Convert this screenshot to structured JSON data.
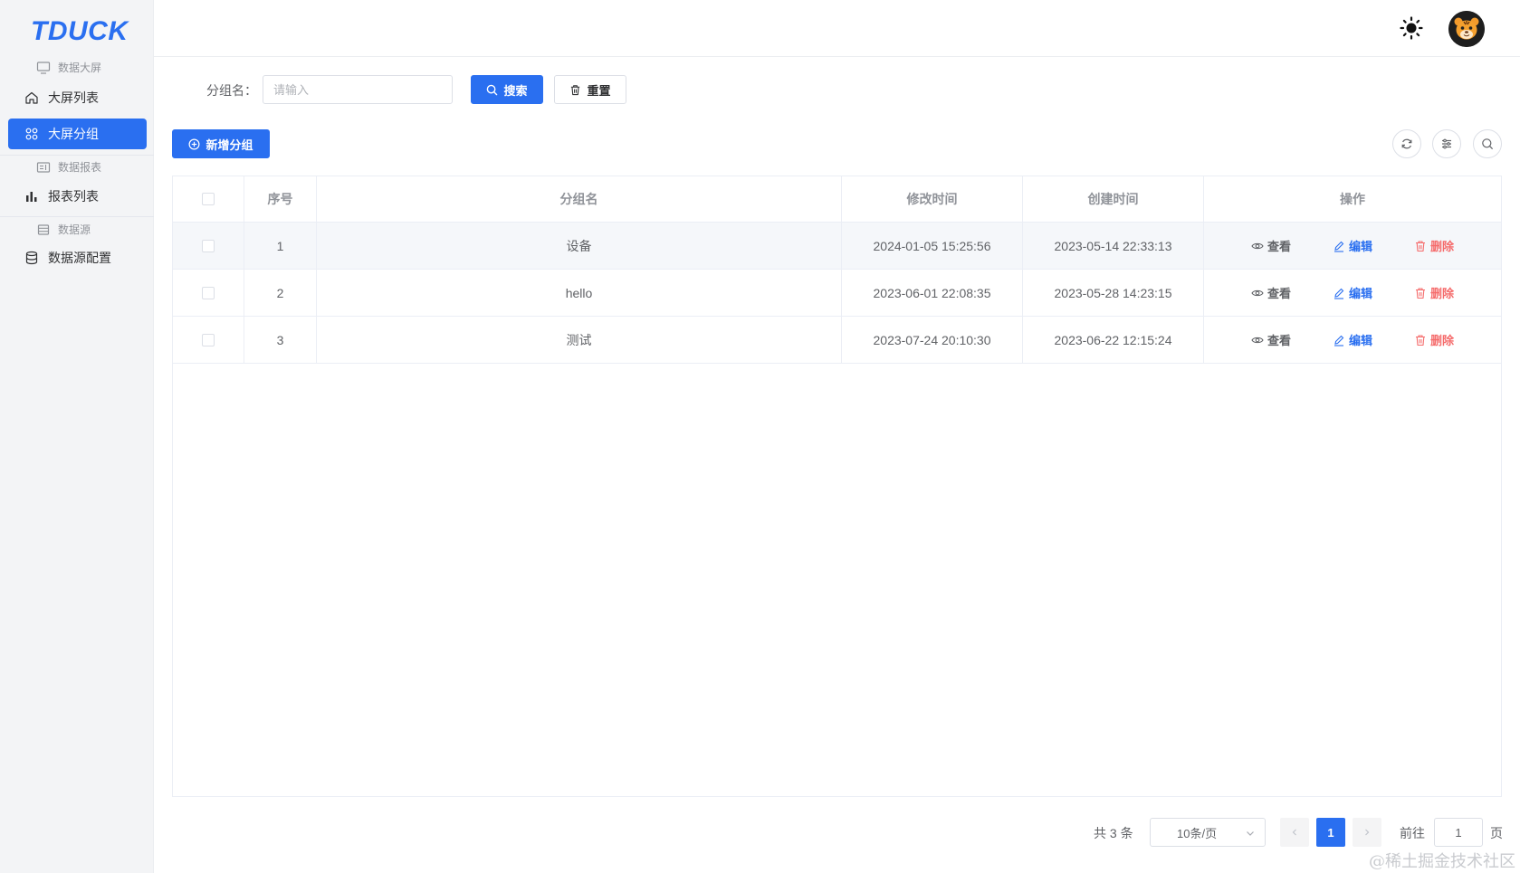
{
  "sidebar": {
    "logo": "TDUCK",
    "groups": [
      {
        "title": "数据大屏",
        "icon": "monitor-icon"
      },
      {
        "title": "数据报表",
        "icon": "report-icon"
      },
      {
        "title": "数据源",
        "icon": "datasource-icon"
      }
    ],
    "items": [
      {
        "label": "大屏列表",
        "icon": "home-icon",
        "active": false
      },
      {
        "label": "大屏分组",
        "icon": "grid-icon",
        "active": true
      },
      {
        "label": "报表列表",
        "icon": "bar-chart-icon",
        "active": false
      },
      {
        "label": "数据源配置",
        "icon": "database-icon",
        "active": false
      }
    ]
  },
  "header": {
    "theme_icon": "sun-icon",
    "avatar": "avatar"
  },
  "search": {
    "label": "分组名：",
    "placeholder": "请输入",
    "value": "",
    "search_button": "搜索",
    "reset_button": "重置"
  },
  "toolbar": {
    "add_button": "新增分组",
    "icons": [
      "refresh-icon",
      "column-settings-icon",
      "search-icon"
    ]
  },
  "table": {
    "headers": [
      "",
      "序号",
      "分组名",
      "修改时间",
      "创建时间",
      "操作"
    ],
    "rows": [
      {
        "idx": "1",
        "name": "设备",
        "modified": "2024-01-05 15:25:56",
        "created": "2023-05-14 22:33:13"
      },
      {
        "idx": "2",
        "name": "hello",
        "modified": "2023-06-01 22:08:35",
        "created": "2023-05-28 14:23:15"
      },
      {
        "idx": "3",
        "name": "测试",
        "modified": "2023-07-24 20:10:30",
        "created": "2023-06-22 12:15:24"
      }
    ],
    "actions": {
      "view": "查看",
      "edit": "编辑",
      "delete": "删除"
    }
  },
  "pagination": {
    "total": "共 3 条",
    "page_size": "10条/页",
    "current_page": "1",
    "goto_label": "前往",
    "goto_value": "1",
    "goto_unit": "页"
  },
  "watermark": "@稀土掘金技术社区",
  "colors": {
    "primary": "#2a6ff0",
    "danger": "#f56c6c",
    "sidebar_bg": "#f3f4f6"
  }
}
